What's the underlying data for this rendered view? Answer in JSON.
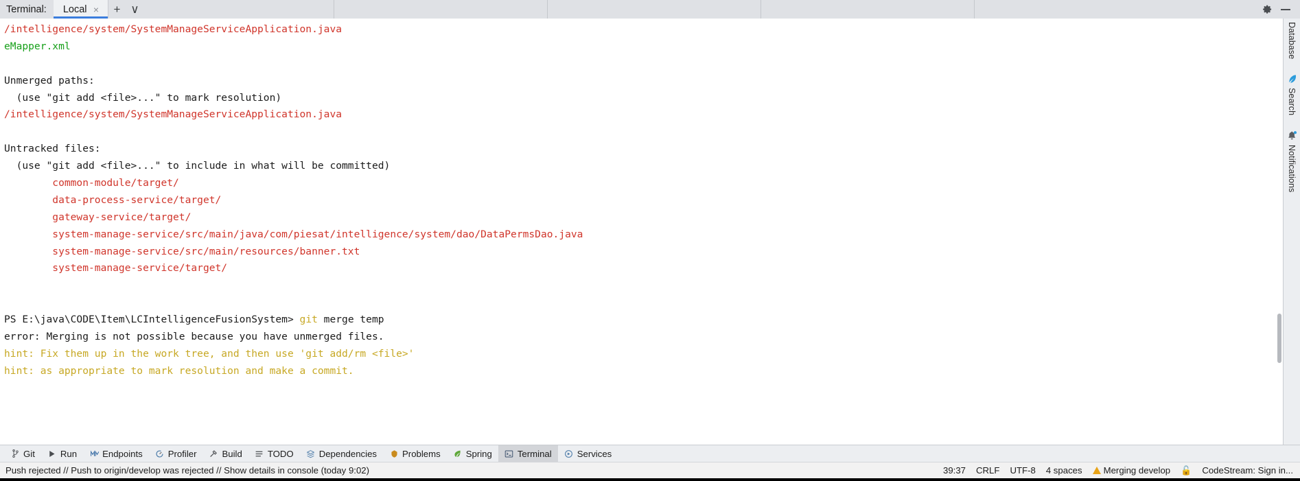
{
  "header": {
    "terminal_label": "Terminal:",
    "tab_name": "Local",
    "close_glyph": "×",
    "add_glyph": "+",
    "dropdown_glyph": "∨",
    "settings_icon": "gear-icon",
    "minimize_icon": "minimize-icon"
  },
  "terminal": {
    "lines": [
      {
        "text": "/intelligence/system/SystemManageServiceApplication.java",
        "color": "red"
      },
      {
        "text": "eMapper.xml",
        "color": "green"
      },
      {
        "text": "",
        "color": "plain"
      },
      {
        "text": "Unmerged paths:",
        "color": "plain"
      },
      {
        "text": "  (use \"git add <file>...\" to mark resolution)",
        "color": "plain"
      },
      {
        "text": "/intelligence/system/SystemManageServiceApplication.java",
        "color": "red"
      },
      {
        "text": "",
        "color": "plain"
      },
      {
        "text": "Untracked files:",
        "color": "plain"
      },
      {
        "text": "  (use \"git add <file>...\" to include in what will be committed)",
        "color": "plain"
      },
      {
        "text": "        common-module/target/",
        "color": "red"
      },
      {
        "text": "        data-process-service/target/",
        "color": "red"
      },
      {
        "text": "        gateway-service/target/",
        "color": "red"
      },
      {
        "text": "        system-manage-service/src/main/java/com/piesat/intelligence/system/dao/DataPermsDao.java",
        "color": "red"
      },
      {
        "text": "        system-manage-service/src/main/resources/banner.txt",
        "color": "red"
      },
      {
        "text": "        system-manage-service/target/",
        "color": "red"
      },
      {
        "text": "",
        "color": "plain"
      },
      {
        "text": "",
        "color": "plain"
      },
      {
        "segments": [
          {
            "text": "PS E:\\java\\CODE\\Item\\LCIntelligenceFusionSystem> ",
            "color": "plain"
          },
          {
            "text": "git",
            "color": "yellow"
          },
          {
            "text": " merge temp",
            "color": "plain"
          }
        ]
      },
      {
        "text": "error: Merging is not possible because you have unmerged files.",
        "color": "plain"
      },
      {
        "text": "hint: Fix them up in the work tree, and then use 'git add/rm <file>'",
        "color": "yellow"
      },
      {
        "text": "hint: as appropriate to mark resolution and make a commit.",
        "color": "yellow"
      }
    ]
  },
  "right_rail": {
    "items": [
      {
        "label": "Database",
        "icon": "database-icon"
      },
      {
        "label": "Search",
        "icon": "search-feather-icon"
      },
      {
        "label": "Notifications",
        "icon": "bell-icon"
      }
    ]
  },
  "tool_bar": {
    "items": [
      {
        "label": "Git",
        "icon": "git-branch-icon",
        "active": false
      },
      {
        "label": "Run",
        "icon": "run-play-icon",
        "active": false
      },
      {
        "label": "Endpoints",
        "icon": "endpoints-icon",
        "active": false
      },
      {
        "label": "Profiler",
        "icon": "profiler-icon",
        "active": false
      },
      {
        "label": "Build",
        "icon": "build-hammer-icon",
        "active": false
      },
      {
        "label": "TODO",
        "icon": "todo-list-icon",
        "active": false
      },
      {
        "label": "Dependencies",
        "icon": "dependencies-icon",
        "active": false
      },
      {
        "label": "Problems",
        "icon": "problems-icon",
        "active": false
      },
      {
        "label": "Spring",
        "icon": "spring-leaf-icon",
        "active": false
      },
      {
        "label": "Terminal",
        "icon": "terminal-icon",
        "active": true
      },
      {
        "label": "Services",
        "icon": "services-icon",
        "active": false
      }
    ]
  },
  "status_bar": {
    "message": "Push rejected // Push to origin/develop was rejected // Show details in console (today 9:02)",
    "caret_position": "39:37",
    "line_separator": "CRLF",
    "encoding": "UTF-8",
    "indent": "4 spaces",
    "branch_state": "Merging develop",
    "lock_icon": "unlocked-icon",
    "codestream": "CodeStream: Sign in..."
  },
  "colors": {
    "accent_blue": "#3b7ddd",
    "error_red": "#d0352b",
    "success_green": "#17a01a",
    "hint_yellow": "#c7a824",
    "warn_orange": "#e8a317",
    "chrome_bg": "#dfe1e5"
  }
}
